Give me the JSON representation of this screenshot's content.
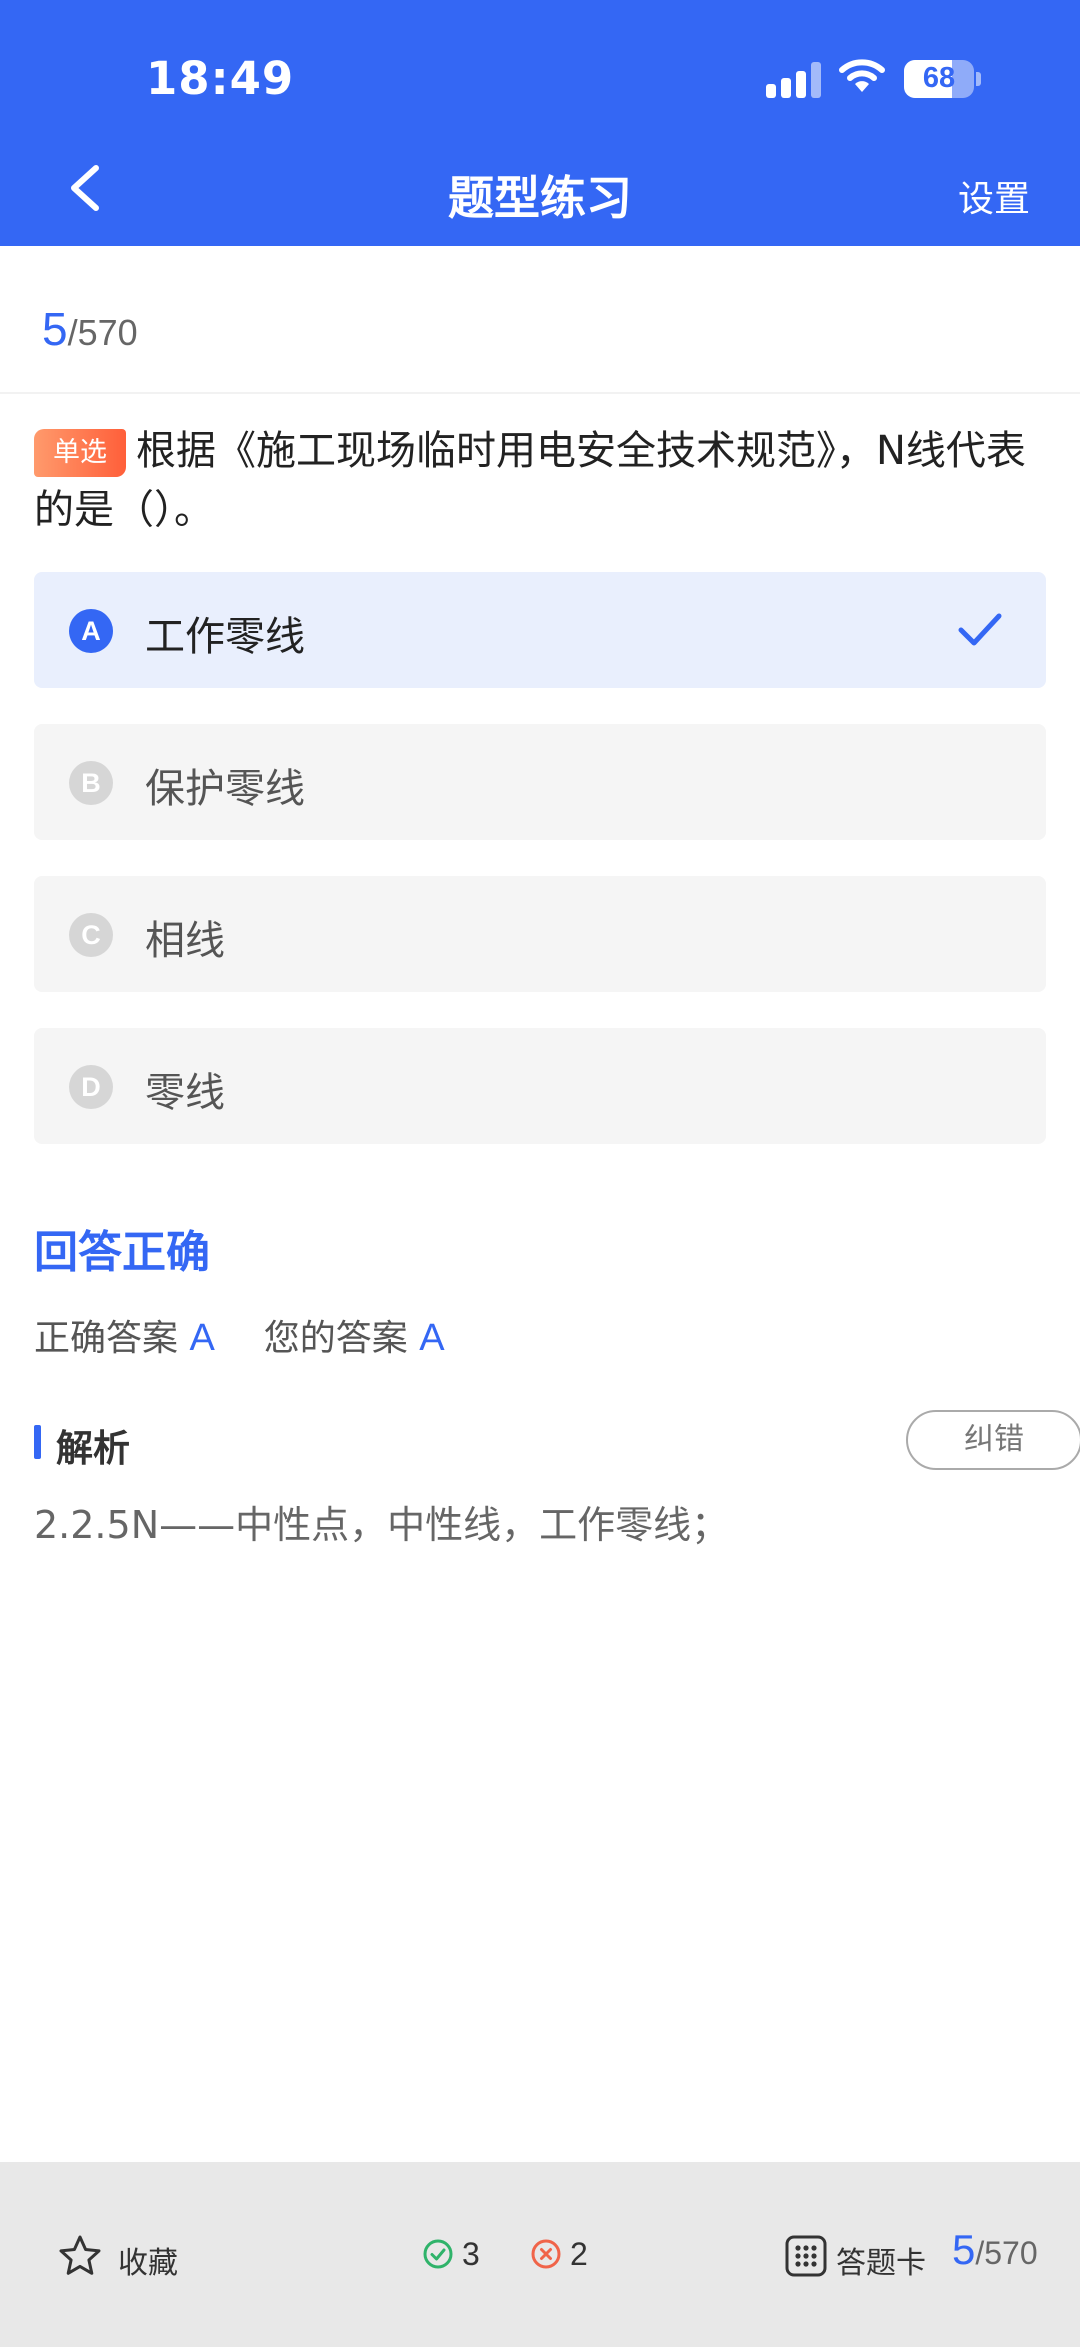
{
  "status_bar": {
    "time": "18:49",
    "battery": "68",
    "battery_level": 0.68
  },
  "header": {
    "title": "题型练习",
    "settings_label": "设置"
  },
  "progress": {
    "current": "5",
    "total": "/570"
  },
  "question": {
    "type_tag": "单选",
    "text": "根据《施工现场临时用电安全技术规范》，N线代表的是（）。"
  },
  "options": [
    {
      "letter": "A",
      "text": "工作零线",
      "selected": true
    },
    {
      "letter": "B",
      "text": "保护零线",
      "selected": false
    },
    {
      "letter": "C",
      "text": "相线",
      "selected": false
    },
    {
      "letter": "D",
      "text": "零线",
      "selected": false
    }
  ],
  "result": {
    "title": "回答正确",
    "correct_label": "正确答案",
    "correct_value": "A",
    "yours_label": "您的答案",
    "yours_value": "A"
  },
  "analysis": {
    "label": "解析",
    "correction_label": "纠错",
    "text": "2.2.5N——中性点，中性线，工作零线；"
  },
  "bottom_bar": {
    "favorite_label": "收藏",
    "correct_count": "3",
    "wrong_count": "2",
    "answer_card_label": "答题卡",
    "current": "5",
    "total": "/570"
  },
  "colors": {
    "accent": "#3467f4",
    "header_bg": "#3467f4",
    "tag": "#ff6a3d",
    "correct": "#2fb36a",
    "wrong": "#f06449"
  }
}
